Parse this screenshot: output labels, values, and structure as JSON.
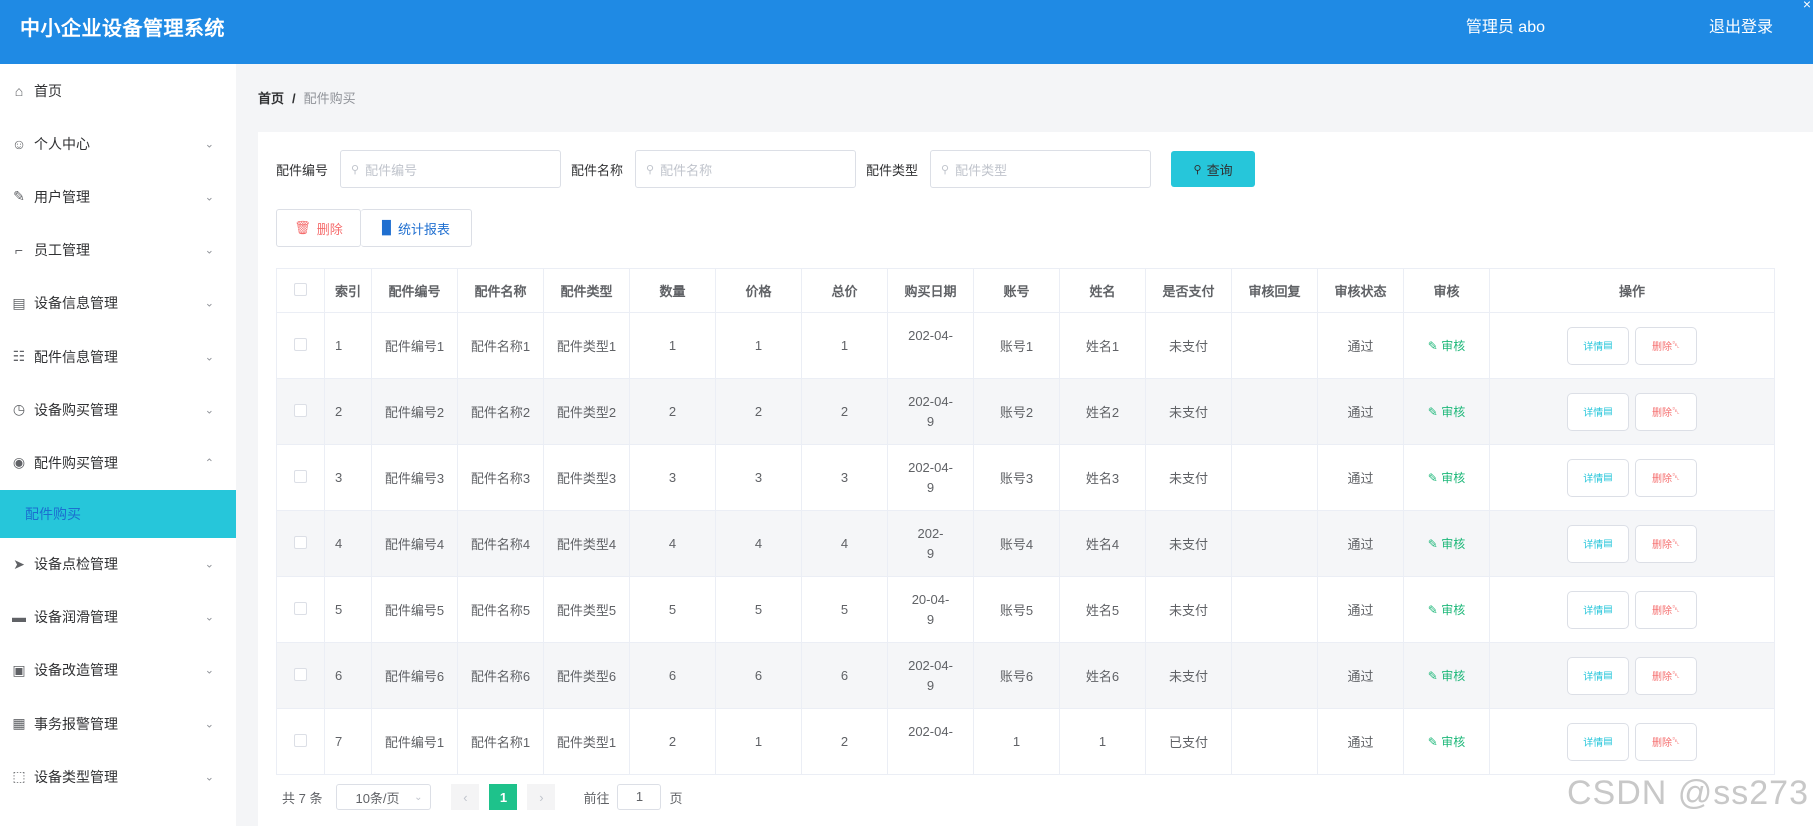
{
  "header": {
    "title": "中小企业设备管理系统",
    "user": "管理员 abo",
    "logout": "退出登录",
    "close": "×"
  },
  "sidebar": {
    "items": [
      {
        "label": "首页",
        "icon": "home-icon",
        "expandable": false
      },
      {
        "label": "个人中心",
        "icon": "user-icon",
        "expandable": true
      },
      {
        "label": "用户管理",
        "icon": "edit-icon",
        "expandable": true
      },
      {
        "label": "员工管理",
        "icon": "crop-icon",
        "expandable": true
      },
      {
        "label": "设备信息管理",
        "icon": "device-icon",
        "expandable": true
      },
      {
        "label": "配件信息管理",
        "icon": "clipboard-icon",
        "expandable": true
      },
      {
        "label": "设备购买管理",
        "icon": "clock-icon",
        "expandable": true
      },
      {
        "label": "配件购买管理",
        "icon": "location-icon",
        "expandable": true,
        "expanded": true,
        "children": [
          {
            "label": "配件购买",
            "active": true
          }
        ]
      },
      {
        "label": "设备点检管理",
        "icon": "send-icon",
        "expandable": true
      },
      {
        "label": "设备润滑管理",
        "icon": "monitor-icon",
        "expandable": true
      },
      {
        "label": "设备改造管理",
        "icon": "briefcase-icon",
        "expandable": true
      },
      {
        "label": "事务报警管理",
        "icon": "grid-icon",
        "expandable": true
      },
      {
        "label": "设备类型管理",
        "icon": "fullscreen-icon",
        "expandable": true
      }
    ]
  },
  "breadcrumb": {
    "home": "首页",
    "separator": "/",
    "current": "配件购买"
  },
  "search": {
    "fields": [
      {
        "label": "配件编号",
        "placeholder": "配件编号"
      },
      {
        "label": "配件名称",
        "placeholder": "配件名称"
      },
      {
        "label": "配件类型",
        "placeholder": "配件类型"
      }
    ],
    "query_label": "查询"
  },
  "actions": {
    "delete_label": "删除",
    "stats_label": "统计报表"
  },
  "table": {
    "columns": [
      "索引",
      "配件编号",
      "配件名称",
      "配件类型",
      "数量",
      "价格",
      "总价",
      "购买日期",
      "账号",
      "姓名",
      "是否支付",
      "审核回复",
      "审核状态",
      "审核",
      "操作"
    ],
    "rows": [
      {
        "index": "1",
        "code": "配件编号1",
        "name": "配件名称1",
        "type": "配件类型1",
        "qty": "1",
        "price": "1",
        "total": "1",
        "date_top": "202-04-",
        "date_bottom": "",
        "account": "账号1",
        "person": "姓名1",
        "paid": "未支付",
        "reply": "",
        "status": "通过"
      },
      {
        "index": "2",
        "code": "配件编号2",
        "name": "配件名称2",
        "type": "配件类型2",
        "qty": "2",
        "price": "2",
        "total": "2",
        "date_top": "202-04-",
        "date_bottom": "9",
        "account": "账号2",
        "person": "姓名2",
        "paid": "未支付",
        "reply": "",
        "status": "通过"
      },
      {
        "index": "3",
        "code": "配件编号3",
        "name": "配件名称3",
        "type": "配件类型3",
        "qty": "3",
        "price": "3",
        "total": "3",
        "date_top": "202-04-",
        "date_bottom": "9",
        "account": "账号3",
        "person": "姓名3",
        "paid": "未支付",
        "reply": "",
        "status": "通过"
      },
      {
        "index": "4",
        "code": "配件编号4",
        "name": "配件名称4",
        "type": "配件类型4",
        "qty": "4",
        "price": "4",
        "total": "4",
        "date_top": "202-",
        "date_bottom": "9",
        "account": "账号4",
        "person": "姓名4",
        "paid": "未支付",
        "reply": "",
        "status": "通过"
      },
      {
        "index": "5",
        "code": "配件编号5",
        "name": "配件名称5",
        "type": "配件类型5",
        "qty": "5",
        "price": "5",
        "total": "5",
        "date_top": "20-04-",
        "date_bottom": "9",
        "account": "账号5",
        "person": "姓名5",
        "paid": "未支付",
        "reply": "",
        "status": "通过"
      },
      {
        "index": "6",
        "code": "配件编号6",
        "name": "配件名称6",
        "type": "配件类型6",
        "qty": "6",
        "price": "6",
        "total": "6",
        "date_top": "202-04-",
        "date_bottom": "9",
        "account": "账号6",
        "person": "姓名6",
        "paid": "未支付",
        "reply": "",
        "status": "通过"
      },
      {
        "index": "7",
        "code": "配件编号1",
        "name": "配件名称1",
        "type": "配件类型1",
        "qty": "2",
        "price": "1",
        "total": "2",
        "date_top": "202-04-",
        "date_bottom": "",
        "account": "1",
        "person": "1",
        "paid": "已支付",
        "reply": "",
        "status": "通过"
      }
    ],
    "audit_label": "审核",
    "detail_label": "详情",
    "row_delete_label": "删除"
  },
  "pagination": {
    "total_text": "共 7 条",
    "page_size": "10条/页",
    "prev": "‹",
    "next": "›",
    "current_page": "1",
    "goto_prefix": "前往",
    "goto_value": "1",
    "goto_suffix": "页"
  },
  "watermark": "CSDN @ss273"
}
